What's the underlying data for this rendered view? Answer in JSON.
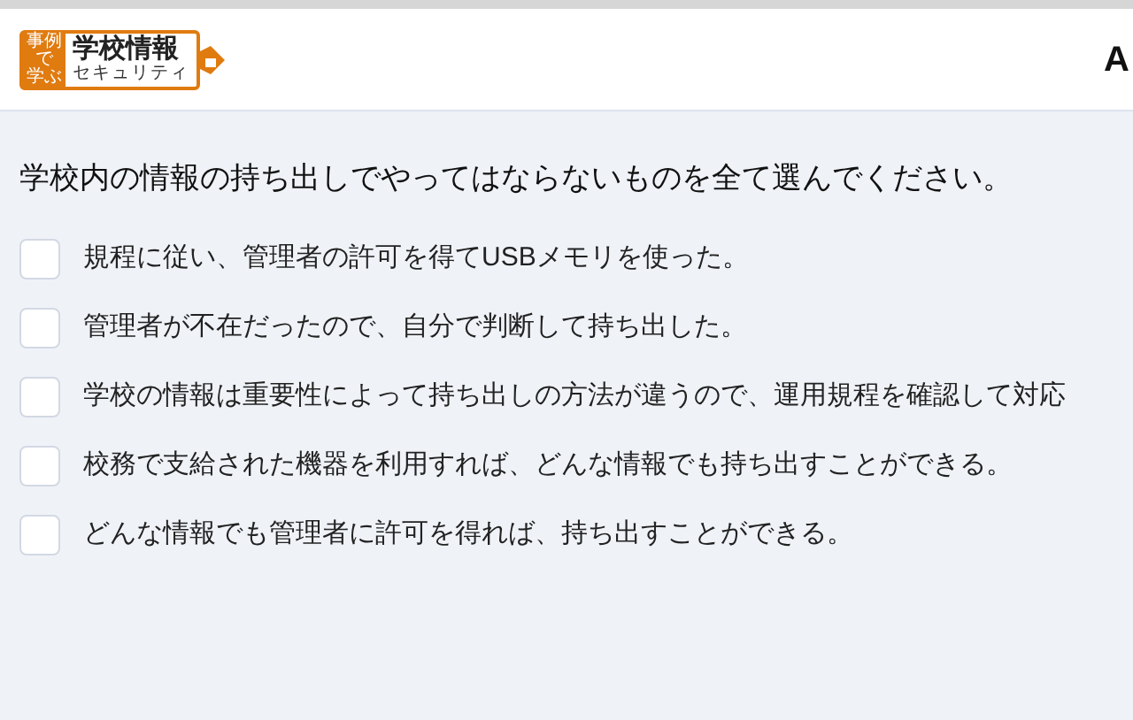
{
  "header": {
    "logo": {
      "badge": [
        "事例",
        "で",
        "学ぶ"
      ],
      "title": "学校情報",
      "subtitle": "セキュリティ"
    },
    "right_text": "A"
  },
  "question": "学校内の情報の持ち出しでやってはならないものを全て選んでください。",
  "options": [
    {
      "label": "規程に従い、管理者の許可を得てUSBメモリを使った。",
      "checked": false
    },
    {
      "label": "管理者が不在だったので、自分で判断して持ち出した。",
      "checked": false
    },
    {
      "label": "学校の情報は重要性によって持ち出しの方法が違うので、運用規程を確認して対応",
      "checked": false
    },
    {
      "label": "校務で支給された機器を利用すれば、どんな情報でも持ち出すことができる。",
      "checked": false
    },
    {
      "label": "どんな情報でも管理者に許可を得れば、持ち出すことができる。",
      "checked": false
    }
  ]
}
